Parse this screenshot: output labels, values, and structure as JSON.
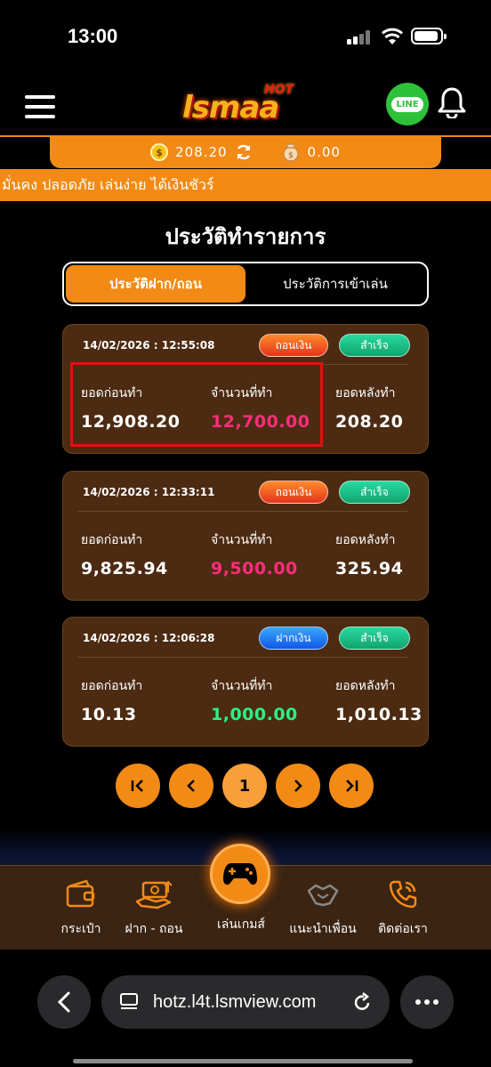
{
  "status_bar": {
    "time": "13:00"
  },
  "header": {
    "logo_main": "lsmaa",
    "logo_hot": "HOT",
    "line_label": "LINE"
  },
  "balance": {
    "credit": "208.20",
    "points": "0.00"
  },
  "marquee": "มั่นคง ปลอดภัย เล่นง่าย ได้เงินชัวร์",
  "page": {
    "title": "ประวัติทำรายการ"
  },
  "tabs": [
    {
      "label": "ประวัติฝาก/ถอน",
      "active": true
    },
    {
      "label": "ประวัติการเข้าเล่น",
      "active": false
    }
  ],
  "columns": {
    "before": "ยอดก่อนทำ",
    "amount": "จำนวนที่ทำ",
    "after": "ยอดหลังทำ"
  },
  "transactions": [
    {
      "datetime": "14/02/2026 : 12:55:08",
      "type": "ถอนเงิน",
      "status": "สำเร็จ",
      "before": "12,908.20",
      "amount": "12,700.00",
      "after": "208.20"
    },
    {
      "datetime": "14/02/2026 : 12:33:11",
      "type": "ถอนเงิน",
      "status": "สำเร็จ",
      "before": "9,825.94",
      "amount": "9,500.00",
      "after": "325.94"
    },
    {
      "datetime": "14/02/2026 : 12:06:28",
      "type": "ฝากเงิน",
      "status": "สำเร็จ",
      "before": "10.13",
      "amount": "1,000.00",
      "after": "1,010.13"
    }
  ],
  "pagination": {
    "current": "1"
  },
  "bottom_nav": {
    "wallet": "กระเป๋า",
    "deposit_withdraw": "ฝาก - ถอน",
    "play": "เล่นเกมส์",
    "refer": "แนะนำเพื่อน",
    "contact": "ติดต่อเรา"
  },
  "browser": {
    "url": "hotz.l4t.lsmview.com"
  },
  "colors": {
    "accent": "#f28a16",
    "card": "#4c2b12",
    "withdraw_amount": "#ff2d7a",
    "deposit_amount": "#2cf08a"
  }
}
